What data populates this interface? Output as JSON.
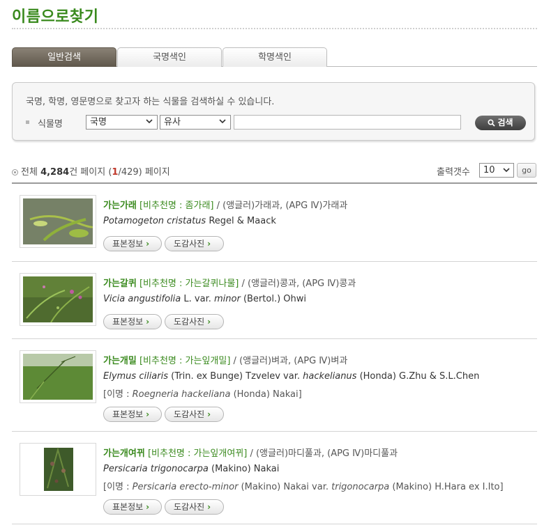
{
  "page_title": "이름으로찾기",
  "tabs": [
    {
      "label": "일반검색",
      "active": true
    },
    {
      "label": "국명색인",
      "active": false
    },
    {
      "label": "학명색인",
      "active": false
    }
  ],
  "search": {
    "description": "국명, 학명, 영문명으로 찾고자 하는 식물을 검색하실 수 있습니다.",
    "field_label": "식물명",
    "name_type_selected": "국명",
    "match_type_selected": "유사",
    "query_value": "",
    "button_label": "검색"
  },
  "results": {
    "total_prefix": "전체",
    "total_count": "4,284",
    "unit_and_page": "건 페이지",
    "current_page": "1",
    "total_pages": "/429)",
    "page_suffix": "페이지",
    "open_paren": "(",
    "per_page_label": "출력갯수",
    "per_page_selected": "10",
    "go_label": "go"
  },
  "items": [
    {
      "korean_name": "가는가래",
      "alt_name": "[비추천명 : 좀가래]",
      "family": " / (앵글러)가래과, (APG Ⅳ)가래과",
      "sci_genus_species": "Potamogeton cristatus",
      "sci_rest": " Regel & Maack",
      "specimen_button": "표본정보",
      "photo_button": "도감사진"
    },
    {
      "korean_name": "가는갈퀴",
      "alt_name": "[비추천명 : 가는갈퀴나물]",
      "family": " / (앵글러)콩과, (APG Ⅳ)콩과",
      "sci_genus_species": "Vicia angustifolia",
      "sci_mid": " L. var. ",
      "sci_var": "minor",
      "sci_rest": " (Bertol.) Ohwi",
      "specimen_button": "표본정보",
      "photo_button": "도감사진"
    },
    {
      "korean_name": "가는개밀",
      "alt_name": "[비추천명 : 가는잎개밀]",
      "family": " / (앵글러)벼과, (APG Ⅳ)벼과",
      "sci_genus_species": "Elymus ciliaris",
      "sci_mid": " (Trin. ex Bunge) Tzvelev var. ",
      "sci_var": "hackelianus",
      "sci_rest": " (Honda) G.Zhu & S.L.Chen",
      "syn_prefix": "[이명 : ",
      "syn_name": "Roegneria hackeliana",
      "syn_rest": " (Honda) Nakai]",
      "specimen_button": "표본정보",
      "photo_button": "도감사진"
    },
    {
      "korean_name": "가는개여뀌",
      "alt_name": "[비추천명 : 가는잎개여뀌]",
      "family": " / (앵글러)마디풀과, (APG Ⅳ)마디풀과",
      "sci_genus_species": "Persicaria trigonocarpa",
      "sci_rest": " (Makino) Nakai",
      "syn_prefix": "[이명 : ",
      "syn_name": "Persicaria erecto-minor",
      "syn_mid": " (Makino) Nakai var. ",
      "syn_var": "trigonocarpa",
      "syn_rest": " (Makino) H.Hara ex I.Ito]",
      "specimen_button": "표본정보",
      "photo_button": "도감사진"
    }
  ]
}
